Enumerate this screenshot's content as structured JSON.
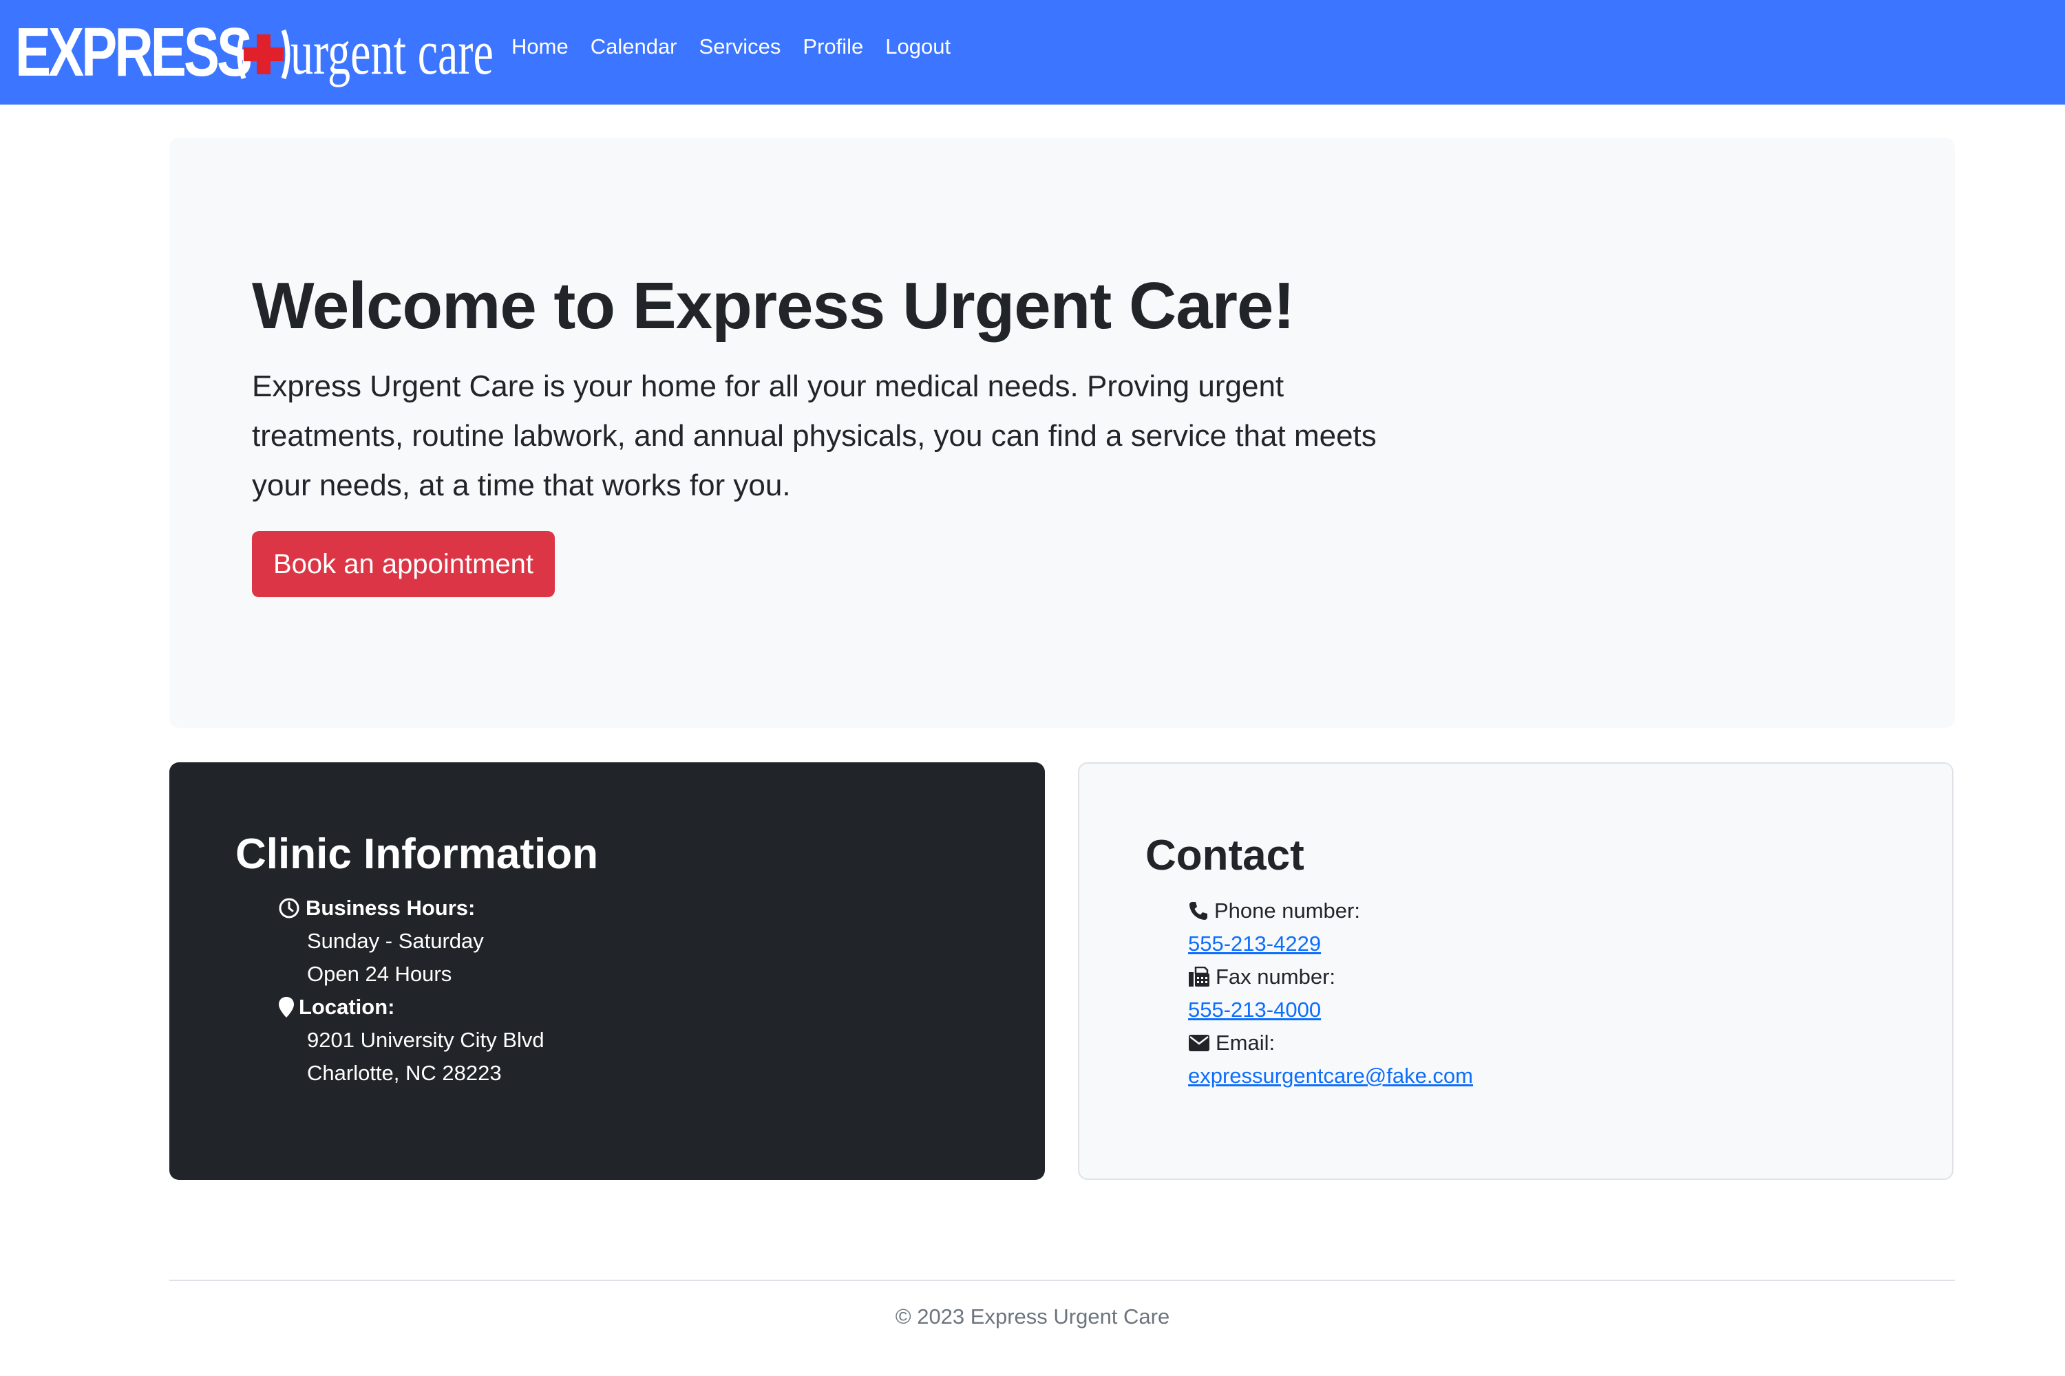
{
  "brand": {
    "logo_express": "EXPRESS",
    "logo_urgent": "urgent care",
    "colors": {
      "navbar": "#3c75ff",
      "cross": "#e0202a",
      "primary_button": "#dc3545",
      "link": "#0d6efd"
    }
  },
  "nav": {
    "items": [
      {
        "label": "Home"
      },
      {
        "label": "Calendar"
      },
      {
        "label": "Services"
      },
      {
        "label": "Profile"
      },
      {
        "label": "Logout"
      }
    ]
  },
  "hero": {
    "title": "Welcome to Express Urgent Care!",
    "text": "Express Urgent Care is your home for all your medical needs. Proving urgent treatments, routine labwork, and annual physicals, you can find a service that meets your needs, at a time that works for you.",
    "button_label": "Book an appointment"
  },
  "clinic": {
    "title": "Clinic Information",
    "hours_label": "Business Hours:",
    "hours_icon": "clock-icon",
    "days": "Sunday - Saturday",
    "hours": "Open 24 Hours",
    "location_label": "Location:",
    "location_icon": "map-pin-icon",
    "address_line1": "9201 University City Blvd",
    "address_line2": "Charlotte, NC 28223"
  },
  "contact": {
    "title": "Contact",
    "phone_label": "Phone number:",
    "phone_icon": "phone-icon",
    "phone": "555-213-4229",
    "fax_label": "Fax number:",
    "fax_icon": "fax-icon",
    "fax": "555-213-4000",
    "email_label": "Email:",
    "email_icon": "envelope-icon",
    "email": "expressurgentcare@fake.com"
  },
  "footer": {
    "text": "© 2023 Express Urgent Care"
  }
}
